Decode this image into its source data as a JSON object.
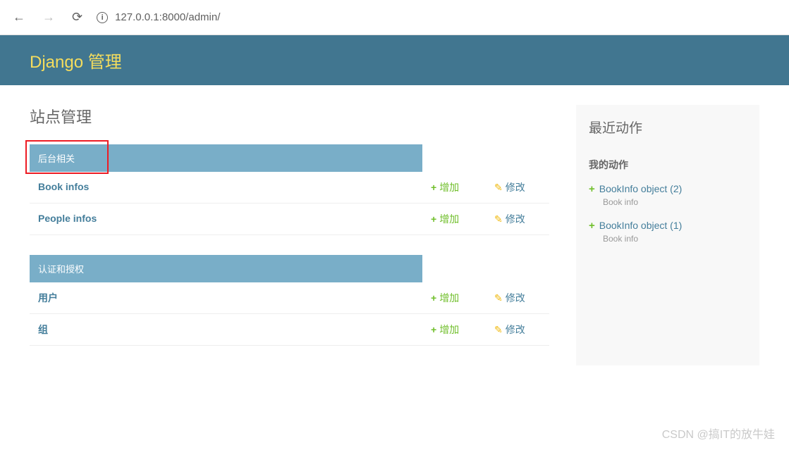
{
  "browser": {
    "url": "127.0.0.1:8000/admin/"
  },
  "header": {
    "title": "Django 管理"
  },
  "main": {
    "title": "站点管理",
    "apps": [
      {
        "caption": "后台相关",
        "highlighted": true,
        "models": [
          {
            "name": "Book infos",
            "add": "增加",
            "change": "修改"
          },
          {
            "name": "People infos",
            "add": "增加",
            "change": "修改"
          }
        ]
      },
      {
        "caption": "认证和授权",
        "highlighted": false,
        "models": [
          {
            "name": "用户",
            "add": "增加",
            "change": "修改"
          },
          {
            "name": "组",
            "add": "增加",
            "change": "修改"
          }
        ]
      }
    ]
  },
  "sidebar": {
    "title": "最近动作",
    "my_actions_label": "我的动作",
    "actions": [
      {
        "label": "BookInfo object (2)",
        "type": "Book info"
      },
      {
        "label": "BookInfo object (1)",
        "type": "Book info"
      }
    ]
  },
  "watermark": "CSDN @搞IT的放牛娃"
}
